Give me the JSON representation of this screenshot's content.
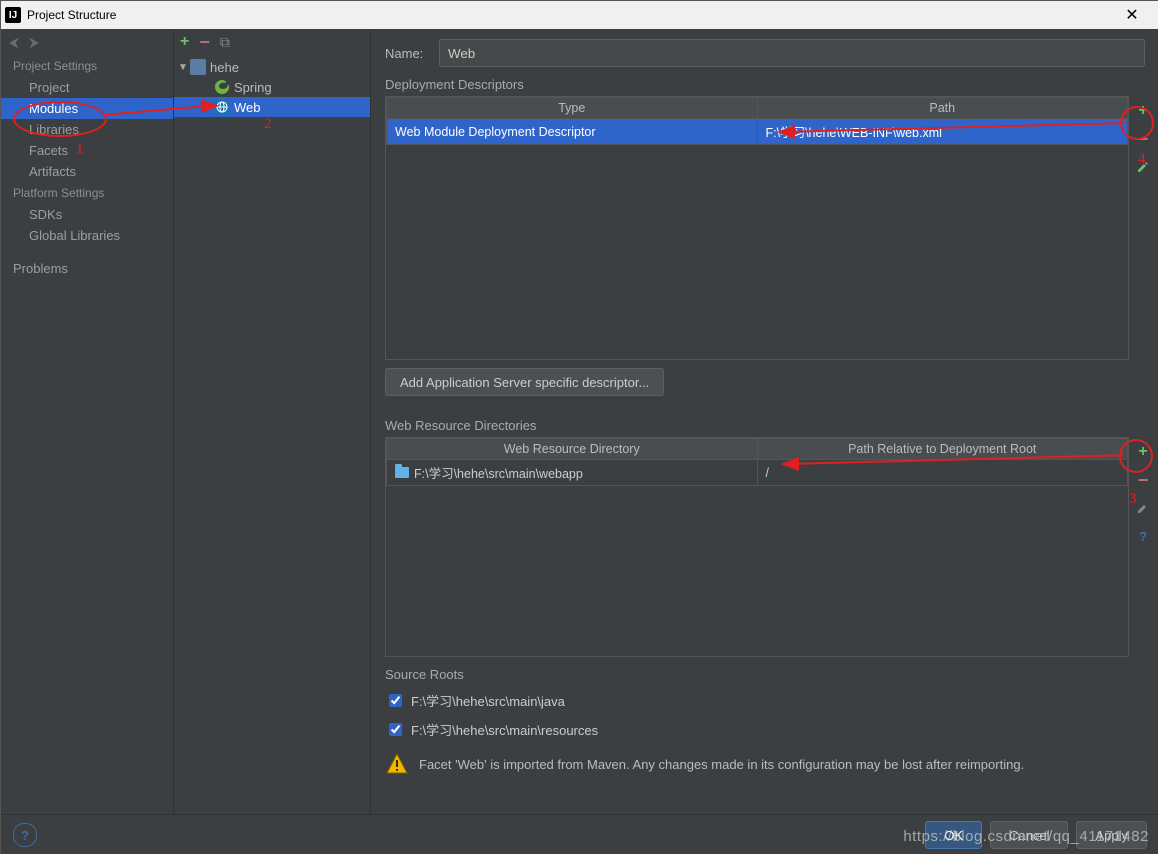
{
  "window": {
    "title": "Project Structure"
  },
  "nav": {
    "sections": {
      "project": "Project Settings",
      "platform": "Platform Settings"
    },
    "items": {
      "project": "Project",
      "modules": "Modules",
      "libraries": "Libraries",
      "facets": "Facets",
      "artifacts": "Artifacts",
      "sdks": "SDKs",
      "globalLibs": "Global Libraries",
      "problems": "Problems"
    }
  },
  "tree": {
    "root": "hehe",
    "children": {
      "spring": "Spring",
      "web": "Web"
    }
  },
  "form": {
    "nameLabel": "Name:",
    "nameValue": "Web"
  },
  "deploy": {
    "label": "Deployment Descriptors",
    "col1": "Type",
    "col2": "Path",
    "rowType": "Web Module Deployment Descriptor",
    "rowPath": "F:\\学习\\hehe\\WEB-INF\\web.xml",
    "addBtn": "Add Application Server specific descriptor..."
  },
  "webres": {
    "label": "Web Resource Directories",
    "col1": "Web Resource Directory",
    "col2": "Path Relative to Deployment Root",
    "rowDir": "F:\\学习\\hehe\\src\\main\\webapp",
    "rowRel": "/"
  },
  "srcroots": {
    "label": "Source Roots",
    "r1": "F:\\学习\\hehe\\src\\main\\java",
    "r2": "F:\\学习\\hehe\\src\\main\\resources"
  },
  "warn": "Facet 'Web' is imported from Maven. Any changes made in its configuration may be lost after reimporting.",
  "footer": {
    "ok": "OK",
    "cancel": "Cancel",
    "apply": "Apply"
  },
  "watermark": "https://blog.csdn.net/qq_41171482",
  "ann": {
    "n1": "1",
    "n2": "2",
    "n3": "3",
    "n4": "4"
  }
}
